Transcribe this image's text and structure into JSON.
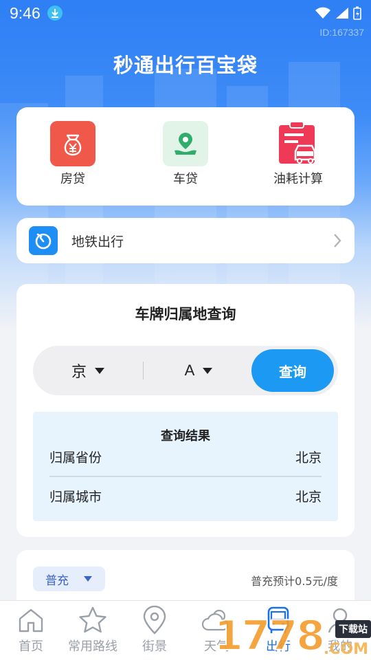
{
  "status_bar": {
    "time": "9:46",
    "id_text": "ID:167337"
  },
  "app_title": "秒通出行百宝袋",
  "tools": [
    {
      "label": "房贷",
      "icon": "money-bag-icon",
      "color": "#f0584a"
    },
    {
      "label": "车贷",
      "icon": "hand-coin-icon",
      "color": "#2fae6b"
    },
    {
      "label": "油耗计算",
      "icon": "car-clipboard-icon",
      "color": "#ee3a57"
    }
  ],
  "metro": {
    "label": "地铁出行",
    "icon": "metro-icon"
  },
  "plate_query": {
    "title": "车牌归属地查询",
    "province": "京",
    "letter": "A",
    "query_button": "查询",
    "result": {
      "title": "查询结果",
      "rows": [
        {
          "label": "归属省份",
          "value": "北京"
        },
        {
          "label": "归属城市",
          "value": "北京"
        }
      ]
    }
  },
  "charging": {
    "type": "普充",
    "note": "普充预计0.5元/度"
  },
  "tabs": [
    {
      "label": "首页",
      "icon": "home-icon",
      "active": false
    },
    {
      "label": "常用路线",
      "icon": "star-icon",
      "active": false
    },
    {
      "label": "街景",
      "icon": "location-pin-icon",
      "active": false
    },
    {
      "label": "天气",
      "icon": "weather-icon",
      "active": false
    },
    {
      "label": "出行",
      "icon": "bus-icon",
      "active": true
    },
    {
      "label": "我的",
      "icon": "user-icon",
      "active": false
    }
  ],
  "watermark": {
    "digits": "1778",
    "domain": ".COM",
    "tag": "下载站"
  },
  "colors": {
    "primary": "#1b99f3",
    "hero": "#2f7ff5",
    "active_tab": "#1b6fe8"
  }
}
